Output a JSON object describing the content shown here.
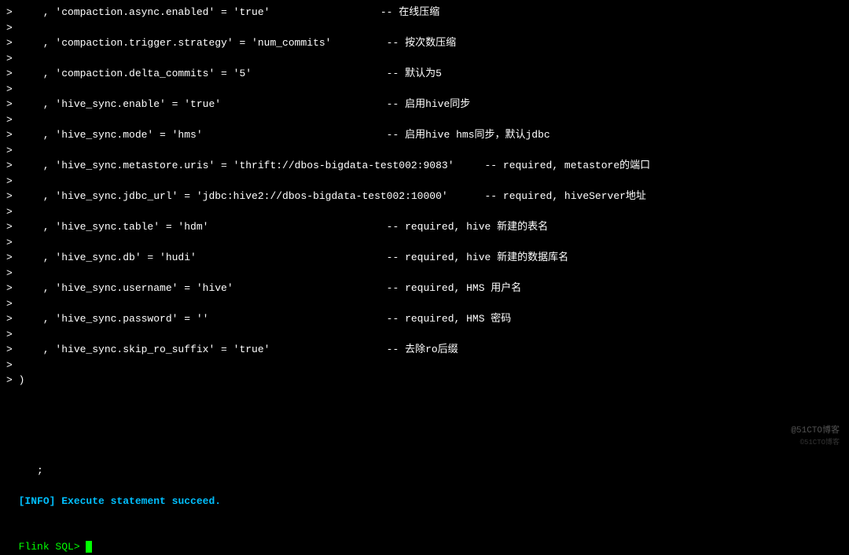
{
  "lines": [
    ">     , 'compaction.async.enabled' = 'true'                  -- 在线压缩",
    ">",
    ">     , 'compaction.trigger.strategy' = 'num_commits'         -- 按次数压缩",
    ">",
    ">     , 'compaction.delta_commits' = '5'                      -- 默认为5",
    ">",
    ">     , 'hive_sync.enable' = 'true'                           -- 启用hive同步",
    ">",
    ">     , 'hive_sync.mode' = 'hms'                              -- 启用hive hms同步，默认jdbc",
    ">",
    ">     , 'hive_sync.metastore.uris' = 'thrift://dbos-bigdata-test002:9083'     -- required, metastore的端口",
    ">",
    ">     , 'hive_sync.jdbc_url' = 'jdbc:hive2://dbos-bigdata-test002:10000'      -- required, hiveServer地址",
    ">",
    ">     , 'hive_sync.table' = 'hdm'                             -- required, hive 新建的表名",
    ">",
    ">     , 'hive_sync.db' = 'hudi'                               -- required, hive 新建的数据库名",
    ">",
    ">     , 'hive_sync.username' = 'hive'                         -- required, HMS 用户名",
    ">",
    ">     , 'hive_sync.password' = ''                             -- required, HMS 密码",
    ">",
    ">     , 'hive_sync.skip_ro_suffix' = 'true'                   -- 去除ro后缀",
    ">",
    "> )"
  ],
  "semicolon_line": "     ;",
  "info_label": "[INFO]",
  "info_text": " Execute statement succeed.",
  "flink_prompt": "Flink SQL> ",
  "watermark": "@51CTO博客",
  "watermark_sub": "©51CTO博客"
}
